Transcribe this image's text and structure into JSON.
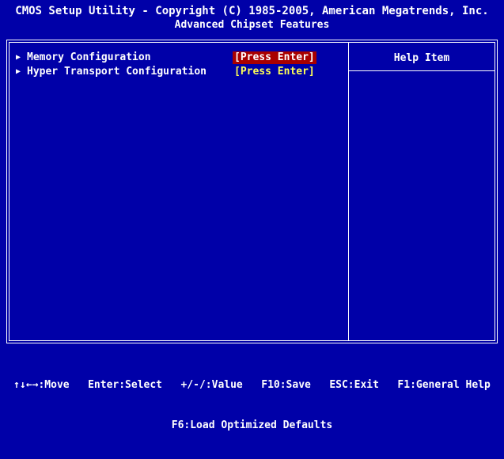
{
  "header": {
    "title": "CMOS Setup Utility - Copyright (C) 1985-2005, American Megatrends, Inc.",
    "subtitle": "Advanced Chipset Features"
  },
  "menu": {
    "items": [
      {
        "label": "Memory Configuration",
        "value": "[Press Enter]",
        "arrow": "▶"
      },
      {
        "label": "Hyper Transport Configuration",
        "value": "[Press Enter]",
        "arrow": "▶"
      }
    ]
  },
  "help": {
    "title": "Help Item"
  },
  "footer": {
    "line1": "↑↓←→:Move   Enter:Select   +/-/:Value   F10:Save   ESC:Exit   F1:General Help",
    "line2": "F6:Load Optimized Defaults"
  },
  "colors": {
    "background": "#0000a8",
    "highlight": "#a80000",
    "value_text": "#ffff55",
    "text": "#ffffff"
  }
}
